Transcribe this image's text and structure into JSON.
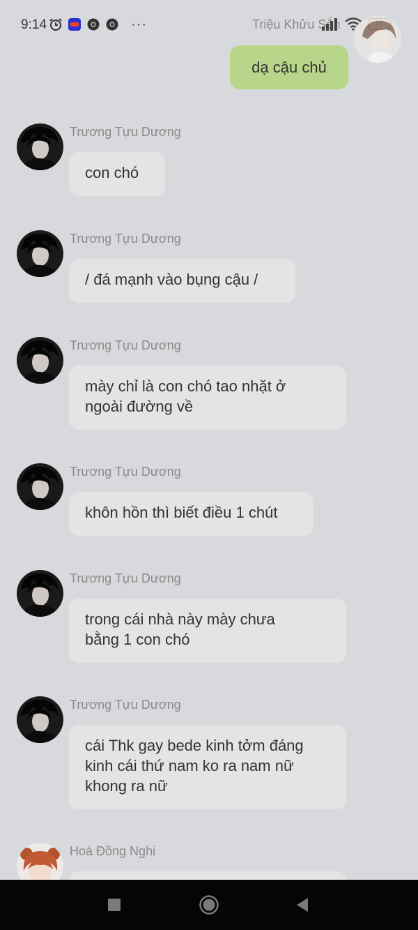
{
  "status_bar": {
    "time": "9:14",
    "carrier_text": "Triệu Khửu Sắn",
    "battery": "77",
    "icons": [
      "alarm-icon",
      "lazada-icon",
      "chrome-icon",
      "chrome-icon",
      "more-dots-icon",
      "signal-icon",
      "wifi-icon",
      "battery-icon"
    ],
    "overflow": "···"
  },
  "colors": {
    "background": "#d8d9dc",
    "self_bubble": "#b8d689",
    "other_bubble": "#e4e4e5",
    "sender_name": "#8a8a8a",
    "nav_bar": "#050505"
  },
  "self_message": {
    "text": "dạ cậu chủ"
  },
  "messages": [
    {
      "sender": "Trương Tựu Dương",
      "lines": [
        "con chó"
      ]
    },
    {
      "sender": "Trương Tựu Dương",
      "lines": [
        "/ đá mạnh vào bụng cậu /"
      ]
    },
    {
      "sender": "Trương Tựu Dương",
      "lines": [
        "mày chỉ là con chó tao nhặt ở",
        "ngoài đường về"
      ]
    },
    {
      "sender": "Trương Tựu Dương",
      "lines": [
        "khôn hồn thì biết điều 1 chút"
      ]
    },
    {
      "sender": "Trương Tựu Dương",
      "lines": [
        "trong cái nhà này mày chưa",
        "bằng 1 con chó"
      ]
    },
    {
      "sender": "Trương Tựu Dương",
      "lines": [
        "cái Thk gay bede kinh tởm đáng",
        "kinh cái thứ nam ko ra nam nữ",
        "khong ra nữ"
      ]
    },
    {
      "sender": "Hoà Đồng Nghi",
      "lines": []
    }
  ],
  "nav_bar": {
    "buttons": [
      "recents-button",
      "home-button",
      "back-button"
    ]
  }
}
